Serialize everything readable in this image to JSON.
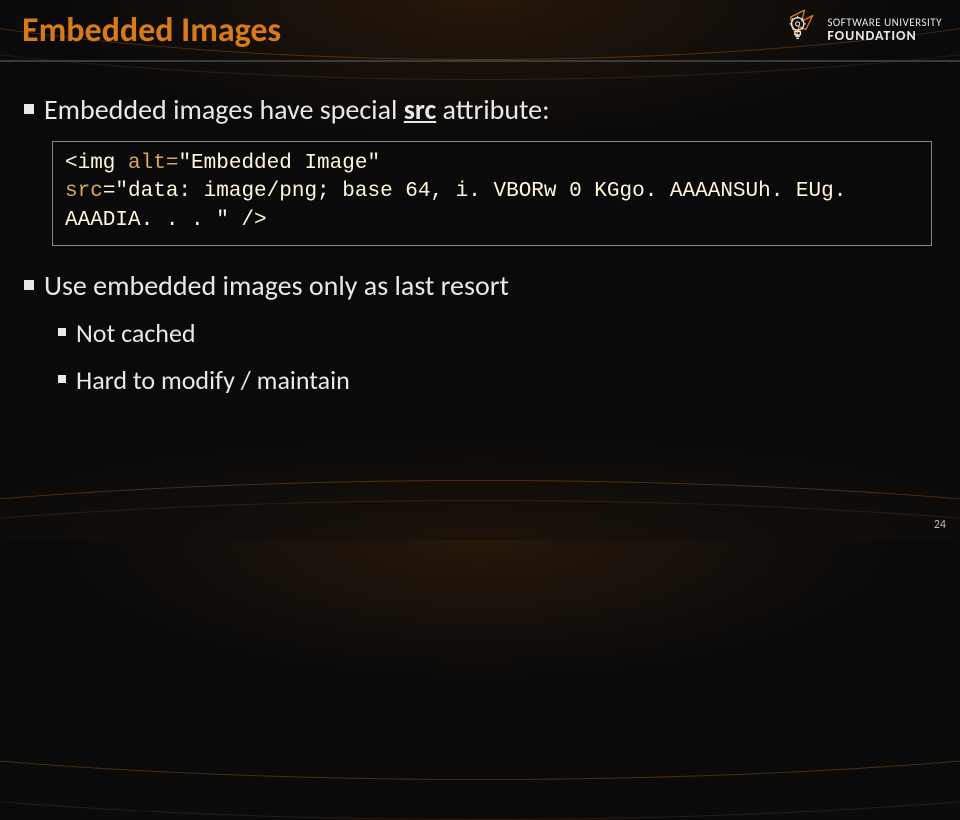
{
  "slide": {
    "title": "Embedded Images",
    "page_number": "24"
  },
  "logo": {
    "line1": "SOFTWARE UNIVERSITY",
    "line2": "FOUNDATION"
  },
  "bullets": {
    "b1_prefix": "Embedded images have special ",
    "b1_src": "src",
    "b1_suffix": " attribute:",
    "b2": "Use embedded images only as last resort",
    "b2a": "Not cached",
    "b2b": "Hard to modify / maintain"
  },
  "code": {
    "line1_a": "<img",
    "line1_b": " alt=",
    "line1_c": "\"Embedded Image\"",
    "line2_a": "src",
    "line2_b": "=",
    "line2_c": "\"data: image/png; base 64, i. VBORw 0 KGgo. AAAANSUh. EUg. AAADIA. . . \"",
    "line2_d": " />"
  }
}
